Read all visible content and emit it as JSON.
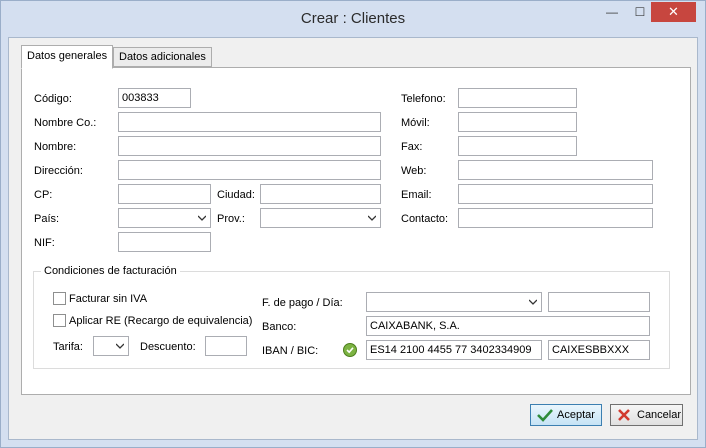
{
  "window": {
    "title": "Crear : Clientes",
    "minimize": "—",
    "maximize": "☐",
    "close": "✕"
  },
  "tabs": [
    {
      "label": "Datos generales",
      "active": true
    },
    {
      "label": "Datos adicionales",
      "active": false
    }
  ],
  "general": {
    "codigo": {
      "label": "Código:",
      "value": "003833"
    },
    "nombre_co": {
      "label": "Nombre Co.:",
      "value": ""
    },
    "nombre": {
      "label": "Nombre:",
      "value": ""
    },
    "direccion": {
      "label": "Dirección:",
      "value": ""
    },
    "cp": {
      "label": "CP:",
      "value": ""
    },
    "ciudad": {
      "label": "Ciudad:",
      "value": ""
    },
    "pais": {
      "label": "País:",
      "value": ""
    },
    "prov": {
      "label": "Prov.:",
      "value": ""
    },
    "nif": {
      "label": "NIF:",
      "value": ""
    },
    "telefono": {
      "label": "Telefono:",
      "value": ""
    },
    "movil": {
      "label": "Móvil:",
      "value": ""
    },
    "fax": {
      "label": "Fax:",
      "value": ""
    },
    "web": {
      "label": "Web:",
      "value": ""
    },
    "email": {
      "label": "Email:",
      "value": ""
    },
    "contacto": {
      "label": "Contacto:",
      "value": ""
    }
  },
  "billing": {
    "title": "Condiciones de facturación",
    "sin_iva": {
      "label": "Facturar sin IVA",
      "checked": false
    },
    "aplicar_re": {
      "label": "Aplicar RE (Recargo de equivalencia)",
      "checked": false
    },
    "tarifa": {
      "label": "Tarifa:",
      "value": ""
    },
    "descuento": {
      "label": "Descuento:",
      "value": ""
    },
    "pago": {
      "label": "F. de pago / Día:",
      "value": "",
      "dia": ""
    },
    "banco": {
      "label": "Banco:",
      "value": "CAIXABANK, S.A."
    },
    "iban": {
      "label": "IBAN / BIC:",
      "value": "ES14 2100 4455 77 3402334909",
      "bic": "CAIXESBBXXX",
      "valid_color": "#7cb342"
    }
  },
  "buttons": {
    "accept": "Aceptar",
    "cancel": "Cancelar"
  }
}
